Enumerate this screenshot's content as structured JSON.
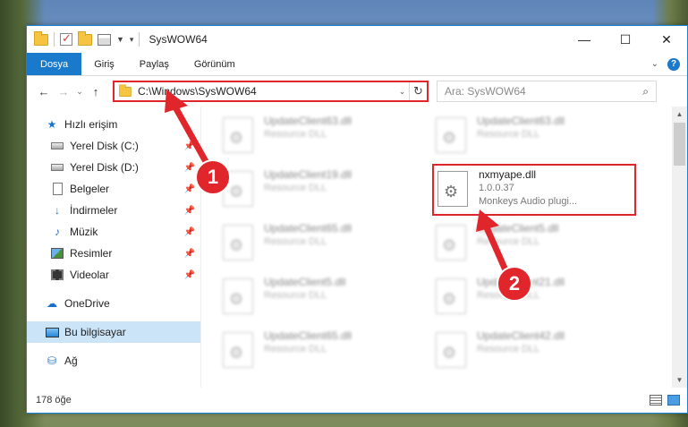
{
  "window": {
    "title": "SysWOW64",
    "controls": {
      "minimize": "—",
      "maximize": "☐",
      "close": "✕"
    }
  },
  "ribbon": {
    "tabs": [
      "Dosya",
      "Giriş",
      "Paylaş",
      "Görünüm"
    ]
  },
  "nav": {
    "address": "C:\\Windows\\SysWOW64",
    "search_placeholder": "Ara: SysWOW64"
  },
  "sidebar": {
    "quick_access": "Hızlı erişim",
    "items": [
      {
        "label": "Yerel Disk (C:)",
        "icon": "disk-icon"
      },
      {
        "label": "Yerel Disk (D:)",
        "icon": "disk-icon"
      },
      {
        "label": "Belgeler",
        "icon": "documents-icon"
      },
      {
        "label": "İndirmeler",
        "icon": "download-icon"
      },
      {
        "label": "Müzik",
        "icon": "music-icon"
      },
      {
        "label": "Resimler",
        "icon": "pictures-icon"
      },
      {
        "label": "Videolar",
        "icon": "videos-icon"
      }
    ],
    "onedrive": "OneDrive",
    "this_pc": "Bu bilgisayar",
    "network": "Ağ"
  },
  "files": [
    {
      "name": "UpdateClient63.dll",
      "sub": "Resource DLL"
    },
    {
      "name": "UpdateClient63.dll",
      "sub": "Resource DLL"
    },
    {
      "name": "UpdateClient19.dll",
      "sub": "Resource DLL"
    },
    {
      "name": "nxmyape.dll",
      "sub": "1.0.0.37",
      "sub2": "Monkeys Audio plugi..."
    },
    {
      "name": "UpdateClient65.dll",
      "sub": "Resource DLL"
    },
    {
      "name": "UpdateClient5.dll",
      "sub": "Resource DLL"
    },
    {
      "name": "UpdateClient5.dll",
      "sub": "Resource DLL"
    },
    {
      "name": "UpdateClient21.dll",
      "sub": "Resource DLL"
    },
    {
      "name": "UpdateClient65.dll",
      "sub": "Resource DLL"
    },
    {
      "name": "UpdateClient42.dll",
      "sub": "Resource DLL"
    }
  ],
  "status": {
    "count": "178 öğe"
  },
  "callouts": [
    "1",
    "2"
  ],
  "colors": {
    "accent": "#1979ca",
    "highlight": "#e0262b",
    "selected": "#cce4f7"
  }
}
